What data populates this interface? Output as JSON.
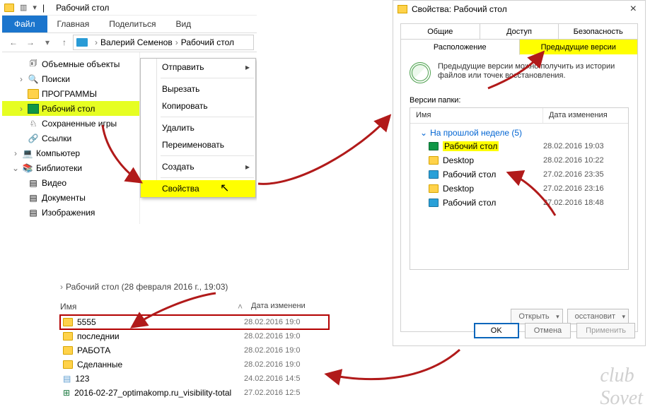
{
  "explorer": {
    "window_title": "Рабочий стол",
    "tabs": {
      "file": "Файл",
      "home": "Главная",
      "share": "Поделиться",
      "view": "Вид"
    },
    "breadcrumbs": [
      "Валерий Семенов",
      "Рабочий стол"
    ],
    "sidebar": {
      "items": [
        {
          "label": "Объемные объекты",
          "level": 2,
          "icon": "objects",
          "expander": ""
        },
        {
          "label": "Поиски",
          "level": 2,
          "icon": "search",
          "expander": "›"
        },
        {
          "label": "ПРОГРАММЫ",
          "level": 2,
          "icon": "folder",
          "expander": ""
        },
        {
          "label": "Рабочий стол",
          "level": 2,
          "icon": "green",
          "expander": "›",
          "highlight": true
        },
        {
          "label": "Сохраненные игры",
          "level": 2,
          "icon": "games",
          "expander": ""
        },
        {
          "label": "Ссылки",
          "level": 2,
          "icon": "links",
          "expander": ""
        },
        {
          "label": "Компьютер",
          "level": 1,
          "icon": "pc",
          "expander": "›"
        },
        {
          "label": "Библиотеки",
          "level": 1,
          "icon": "libs",
          "expander": "⌄"
        },
        {
          "label": "Видео",
          "level": 2,
          "icon": "video",
          "expander": ""
        },
        {
          "label": "Документы",
          "level": 2,
          "icon": "docs",
          "expander": ""
        },
        {
          "label": "Изображения",
          "level": 2,
          "icon": "images",
          "expander": ""
        }
      ]
    },
    "context_menu": {
      "send_to": "Отправить",
      "cut": "Вырезать",
      "copy": "Копировать",
      "delete": "Удалить",
      "rename": "Переименовать",
      "new": "Создать",
      "properties": "Свойства"
    }
  },
  "properties_dialog": {
    "title": "Свойства: Рабочий стол",
    "tabs": {
      "row1": [
        "Общие",
        "Доступ",
        "Безопасность"
      ],
      "row2": [
        "Расположение",
        "Предыдущие версии"
      ]
    },
    "active_tab_index": 4,
    "hint": "Предыдущие версии можно получить из истории файлов или точек восстановления.",
    "versions_label": "Версии папки:",
    "columns": {
      "name": "Имя",
      "date": "Дата изменения"
    },
    "group": "На прошлой неделе (5)",
    "versions": [
      {
        "name": "Рабочий стол",
        "date": "28.02.2016 19:03",
        "icon": "green",
        "highlight": true
      },
      {
        "name": "Desktop",
        "date": "28.02.2016 10:22",
        "icon": "yellow"
      },
      {
        "name": "Рабочий стол",
        "date": "27.02.2016 23:35",
        "icon": "blue"
      },
      {
        "name": "Desktop",
        "date": "27.02.2016 23:16",
        "icon": "yellow"
      },
      {
        "name": "Рабочий стол",
        "date": "27.02.2016 18:48",
        "icon": "blue"
      }
    ],
    "buttons": {
      "open": "Открыть",
      "restore": "осстановит",
      "ok": "OK",
      "cancel": "Отмена",
      "apply": "Применить"
    }
  },
  "folder_view": {
    "path_label": "Рабочий стол (28 февраля 2016 г., 19:03)",
    "columns": {
      "name": "Имя",
      "date": "Дата изменени"
    },
    "rows": [
      {
        "name": "5555",
        "date": "28.02.2016 19:0",
        "icon": "folder",
        "selected": true
      },
      {
        "name": "последнии",
        "date": "28.02.2016 19:0",
        "icon": "folder"
      },
      {
        "name": "РАБОТА",
        "date": "28.02.2016 19:0",
        "icon": "folder"
      },
      {
        "name": "Сделанные",
        "date": "28.02.2016 19:0",
        "icon": "folder"
      },
      {
        "name": "123",
        "date": "24.02.2016 14:5",
        "icon": "file"
      },
      {
        "name": "2016-02-27_optimakomp.ru_visibility-total",
        "date": "27.02.2016 12:5",
        "icon": "excel"
      }
    ]
  },
  "watermark": "club\nSovet",
  "colors": {
    "highlight": "#ffff00",
    "outline_red": "#b30000",
    "arrow": "#b11a1a"
  }
}
